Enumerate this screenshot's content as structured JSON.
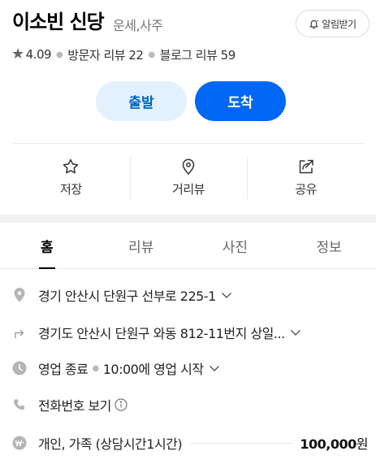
{
  "place": {
    "name": "이소빈 신당",
    "category": "운세,사주",
    "notify_label": "알림받기"
  },
  "meta": {
    "rating": "4.09",
    "visitor_reviews": "방문자 리뷰 22",
    "blog_reviews": "블로그 리뷰 59"
  },
  "route": {
    "depart_label": "출발",
    "arrive_label": "도착"
  },
  "actions": {
    "save_label": "저장",
    "distance_label": "거리뷰",
    "share_label": "공유"
  },
  "tabs": [
    {
      "label": "홈",
      "active": true
    },
    {
      "label": "리뷰",
      "active": false
    },
    {
      "label": "사진",
      "active": false
    },
    {
      "label": "정보",
      "active": false
    }
  ],
  "info": {
    "address": "경기 안산시 단원구 선부로 225-1",
    "jibun_address": "경기도 안산시 단원구 와동 812-11번지 상일...",
    "hours_status": "영업 종료",
    "hours_next": "10:00에 영업 시작",
    "phone_label": "전화번호 보기",
    "price_item": "개인, 가족 (상담시간1시간)",
    "price_value": "100,000",
    "price_unit": "원"
  },
  "colors": {
    "accent": "#0068f5",
    "depart_bg": "#e3f0fe",
    "depart_text": "#0068c3"
  },
  "icons": [
    "bell-icon",
    "star-icon",
    "bookmark-star-icon",
    "map-pin-icon",
    "share-icon",
    "location-icon",
    "route-arrow-icon",
    "clock-icon",
    "phone-icon",
    "info-circle-icon",
    "won-icon",
    "chevron-down-icon"
  ]
}
